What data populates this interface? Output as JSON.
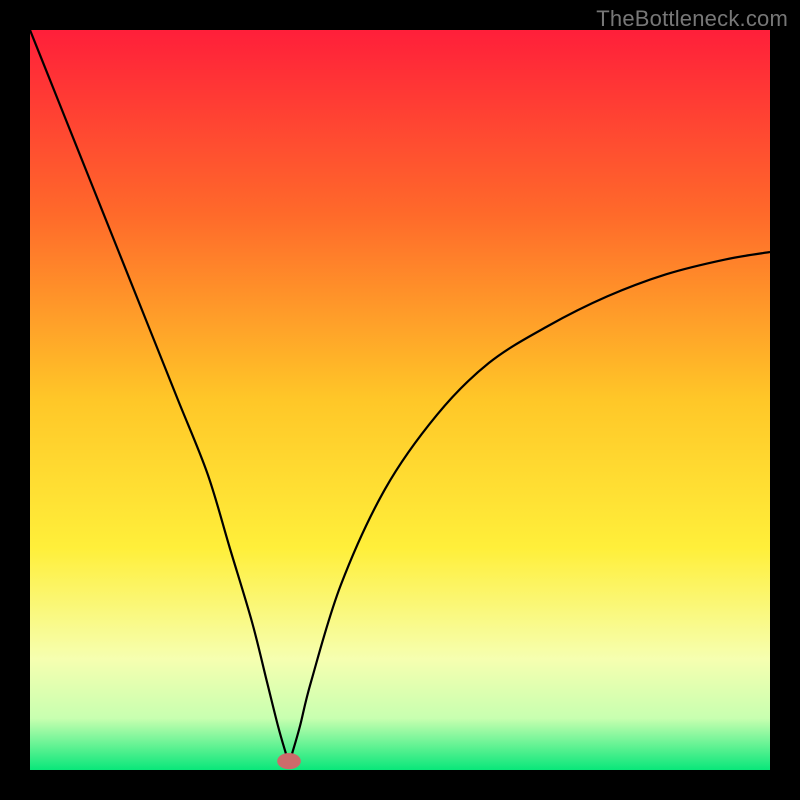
{
  "watermark": "TheBottleneck.com",
  "chart_data": {
    "type": "line",
    "title": "",
    "xlabel": "",
    "ylabel": "",
    "xlim": [
      0,
      100
    ],
    "ylim": [
      0,
      100
    ],
    "background_gradient": {
      "stops": [
        {
          "pos": 0.0,
          "color": "#ff1f3a"
        },
        {
          "pos": 0.25,
          "color": "#ff6a2a"
        },
        {
          "pos": 0.5,
          "color": "#ffc728"
        },
        {
          "pos": 0.7,
          "color": "#ffef3a"
        },
        {
          "pos": 0.85,
          "color": "#f6ffb0"
        },
        {
          "pos": 0.93,
          "color": "#c8ffb0"
        },
        {
          "pos": 1.0,
          "color": "#09e77a"
        }
      ]
    },
    "series": [
      {
        "name": "bottleneck-curve",
        "color": "#000000",
        "x": [
          0,
          4,
          8,
          12,
          16,
          20,
          24,
          27,
          30,
          32,
          33.5,
          34.5,
          35,
          35.5,
          36.5,
          38,
          42,
          48,
          55,
          62,
          70,
          78,
          86,
          94,
          100
        ],
        "y": [
          100,
          90,
          80,
          70,
          60,
          50,
          40,
          30,
          20,
          12,
          6,
          2.5,
          1,
          2.5,
          6,
          12,
          25,
          38,
          48,
          55,
          60,
          64,
          67,
          69,
          70
        ]
      }
    ],
    "marker": {
      "name": "optimal-point",
      "x": 35,
      "y": 1.2,
      "rx": 1.6,
      "ry": 1.1,
      "color": "#cc6b6b"
    }
  }
}
